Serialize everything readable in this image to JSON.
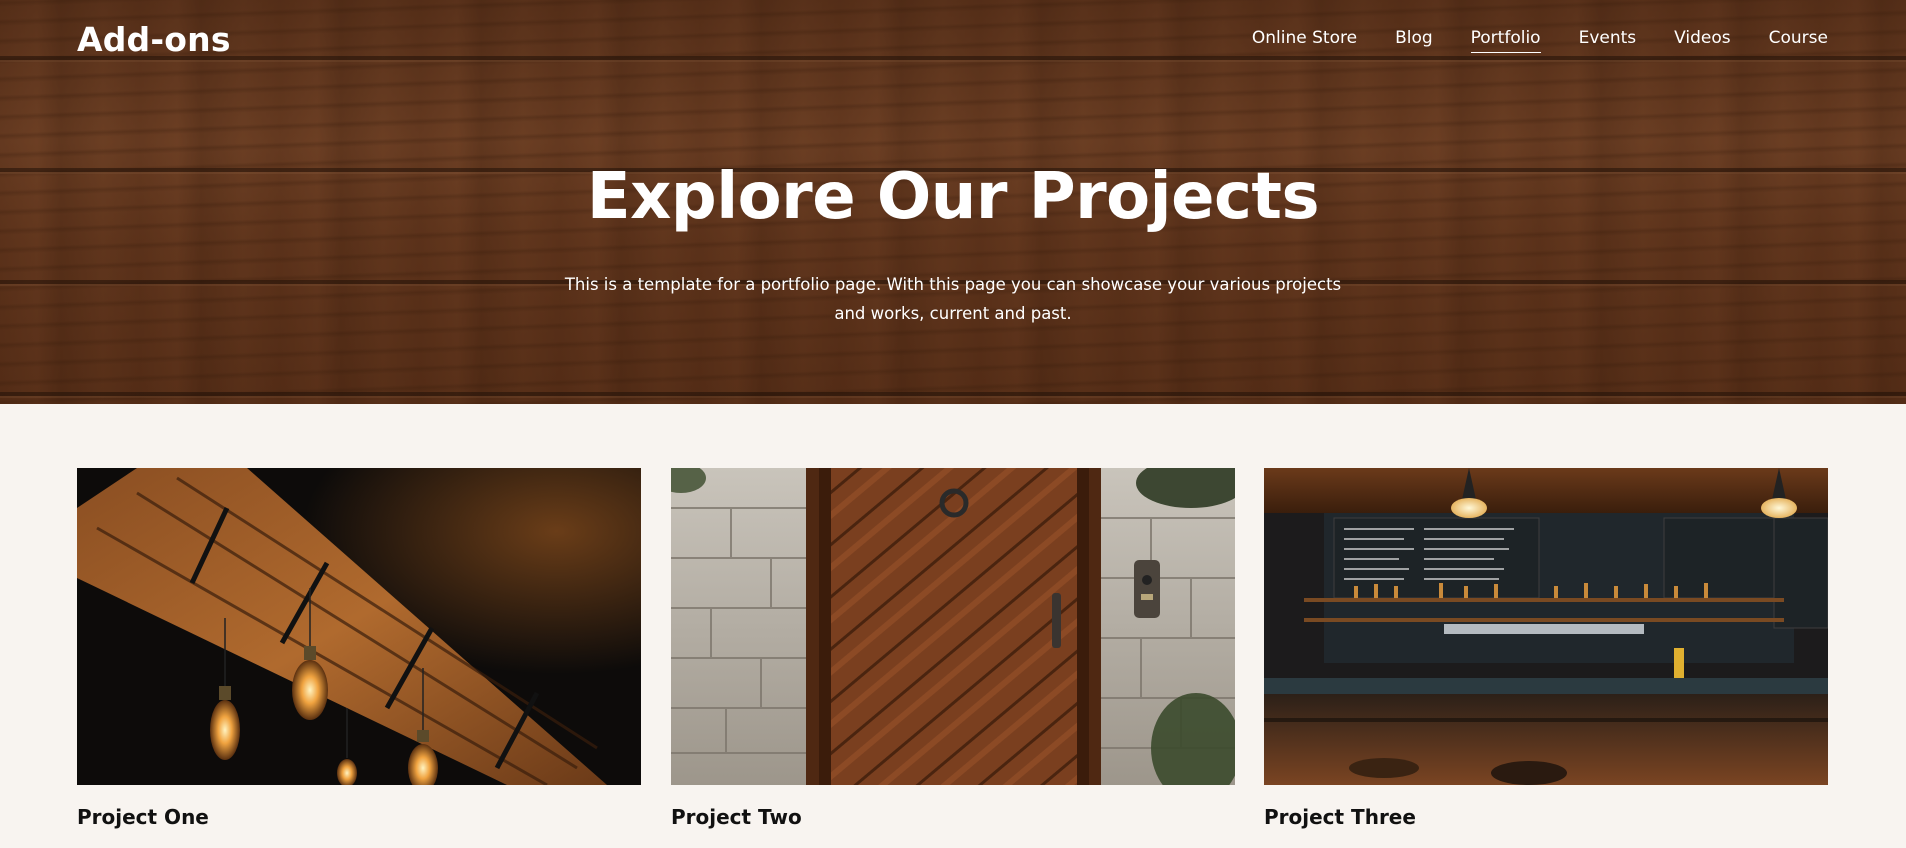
{
  "brand": {
    "logo": "Add-ons"
  },
  "nav": {
    "items": [
      "Online Store",
      "Blog",
      "Portfolio",
      "Events",
      "Videos",
      "Course"
    ],
    "active": "Portfolio"
  },
  "hero": {
    "title": "Explore Our Projects",
    "description": "This is a template for a portfolio page. With this page you can showcase your various projects and works, current and past."
  },
  "projects": [
    {
      "name": "Project One",
      "image": "pendant-lights-on-wooden-beam-photo"
    },
    {
      "name": "Project Two",
      "image": "wooden-door-stone-wall-photo"
    },
    {
      "name": "Project Three",
      "image": "bar-interior-photo"
    }
  ],
  "colors": {
    "page_background": "#f8f4f0",
    "hero_wood": "#7a4526",
    "text_light": "#ffffff",
    "text_dark": "#111111"
  }
}
